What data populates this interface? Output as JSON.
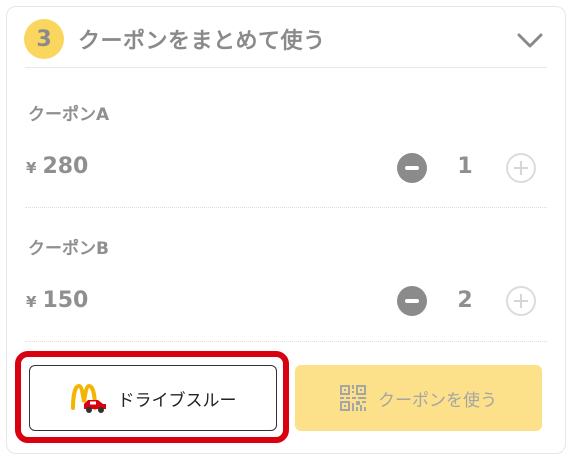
{
  "section": {
    "step_number": "3",
    "title": "クーポンをまとめて使う",
    "chevron_icon": "chevron-down-icon"
  },
  "coupons": [
    {
      "name": "クーポンA",
      "currency": "¥",
      "price": "280",
      "quantity": "1"
    },
    {
      "name": "クーポンB",
      "currency": "¥",
      "price": "150",
      "quantity": "2"
    }
  ],
  "actions": {
    "drive_thru_label": "ドライブスルー",
    "drive_thru_icon": "mcdonalds-drive-thru-icon",
    "use_coupon_label": "クーポンを使う",
    "use_coupon_icon": "qr-code-icon"
  },
  "colors": {
    "accent_yellow": "#fbd65f",
    "button_yellow": "#fde08a",
    "highlight_red": "#d9000f",
    "text_gray": "#8f8f8f"
  }
}
